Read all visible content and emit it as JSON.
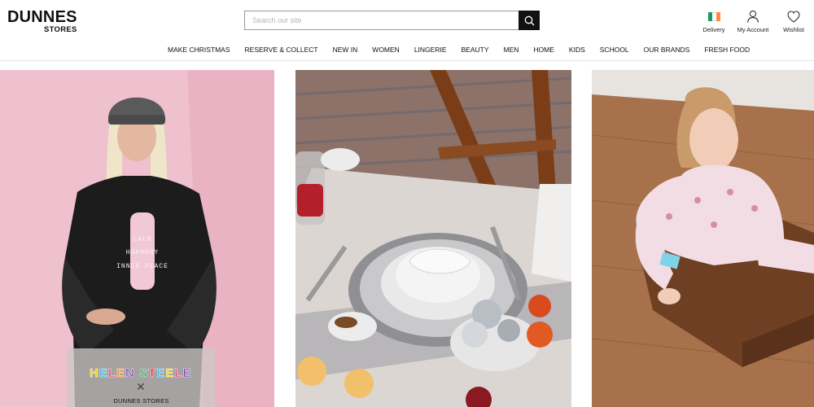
{
  "brand": {
    "line1": "DUNNES",
    "line2": "STORES"
  },
  "search": {
    "placeholder": "Search our site",
    "button_icon": "search-icon"
  },
  "utility": {
    "delivery": {
      "label": "Delivery",
      "icon": "ireland-flag-icon",
      "flag_colors": [
        "#169b62",
        "#ffffff",
        "#ff883e"
      ]
    },
    "account": {
      "label": "My Account",
      "icon": "user-icon"
    },
    "wishlist": {
      "label": "Wishlist",
      "icon": "heart-icon"
    }
  },
  "nav": {
    "items": [
      "MAKE CHRISTMAS",
      "RESERVE & COLLECT",
      "NEW IN",
      "WOMEN",
      "LINGERIE",
      "BEAUTY",
      "MEN",
      "HOME",
      "KIDS",
      "SCHOOL",
      "OUR BRANDS",
      "FRESH FOOD"
    ]
  },
  "tiles": {
    "fashion": {
      "shirt_lines": [
        "CALM",
        "HARMONY",
        "INNER PEACE"
      ],
      "badge": {
        "brand_letters": [
          "H",
          "E",
          "L",
          "E",
          "N",
          " ",
          "S",
          "T",
          "E",
          "E",
          "L",
          "E"
        ],
        "brand_colors": [
          "#f5d300",
          "#2fb3e8",
          "#e83a7a",
          "#f28c1c",
          "#7b3fb5",
          "#ffffff",
          "#25a05a",
          "#e8212b",
          "#2fb3e8",
          "#f5d300",
          "#e83a7a",
          "#7b3fb5"
        ],
        "separator": "✕",
        "partner": "DUNNES STORES"
      }
    },
    "home": {
      "image": "christmas-table-setting"
    },
    "kids": {
      "image": "child-in-wooden-crate"
    }
  }
}
